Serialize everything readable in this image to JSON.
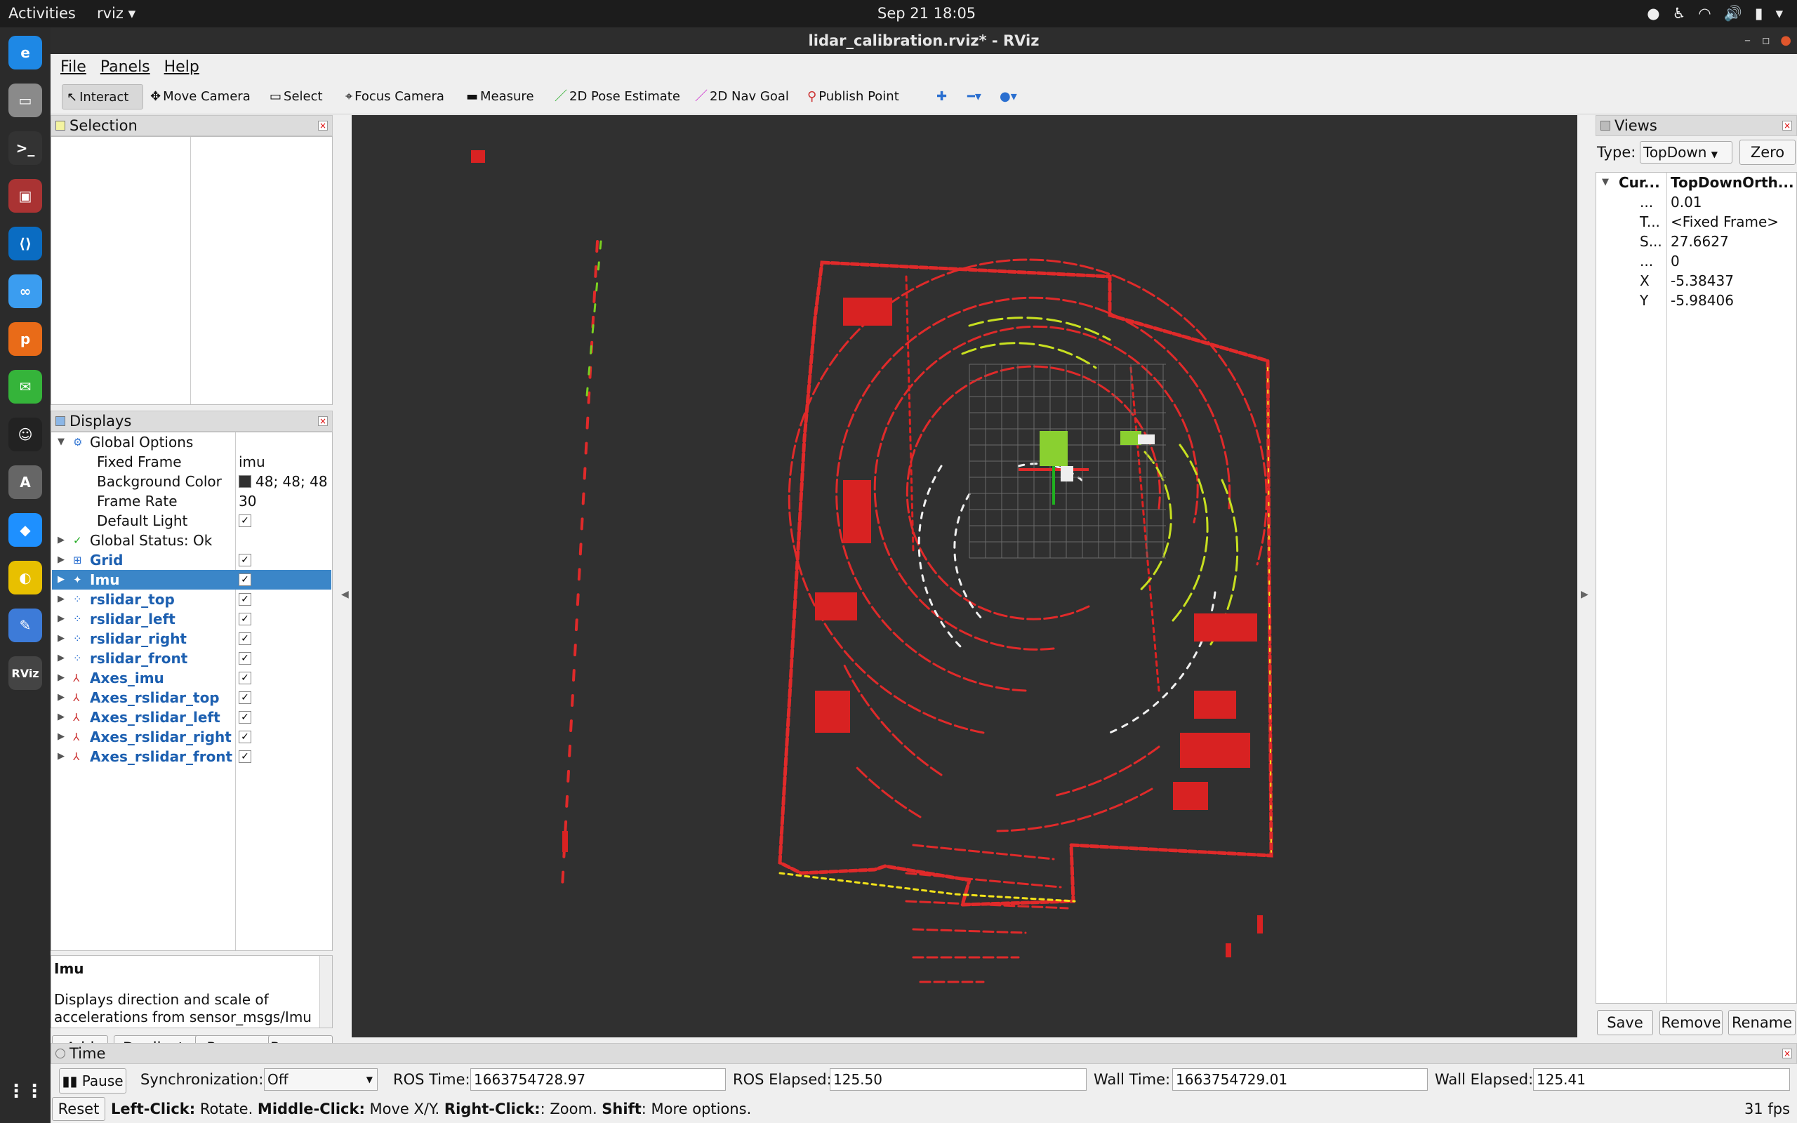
{
  "topbar": {
    "activities": "Activities",
    "app": "rviz",
    "clock": "Sep 21  18:05"
  },
  "window": {
    "title": "lidar_calibration.rviz* - RViz"
  },
  "menu": {
    "file": "File",
    "panels": "Panels",
    "help": "Help"
  },
  "toolbar": {
    "interact": "Interact",
    "move_camera": "Move Camera",
    "select": "Select",
    "focus_camera": "Focus Camera",
    "measure": "Measure",
    "pose_estimate": "2D Pose Estimate",
    "nav_goal": "2D Nav Goal",
    "publish_point": "Publish Point"
  },
  "selection": {
    "title": "Selection"
  },
  "displays": {
    "title": "Displays",
    "global_options": "Global Options",
    "fixed_frame": {
      "name": "Fixed Frame",
      "value": "imu"
    },
    "background_color": {
      "name": "Background Color",
      "value": "48; 48; 48"
    },
    "frame_rate": {
      "name": "Frame Rate",
      "value": "30"
    },
    "default_light": {
      "name": "Default Light"
    },
    "global_status": "Global Status: Ok",
    "items": [
      "Grid",
      "Imu",
      "rslidar_top",
      "rslidar_left",
      "rslidar_right",
      "rslidar_front",
      "Axes_imu",
      "Axes_rslidar_top",
      "Axes_rslidar_left",
      "Axes_rslidar_right",
      "Axes_rslidar_front"
    ],
    "desc_title": "Imu",
    "desc_text": "Displays direction and scale of accelerations from sensor_msgs/Imu",
    "buttons": {
      "add": "Add",
      "duplicate": "Duplicate",
      "remove": "Remove",
      "rename": "Rename"
    }
  },
  "views": {
    "title": "Views",
    "type_label": "Type:",
    "type_value": "TopDown",
    "zero": "Zero",
    "current_name": "Cur...",
    "current_value": "TopDownOrth...",
    "props": [
      {
        "k": "...",
        "v": "0.01"
      },
      {
        "k": "T...",
        "v": "<Fixed Frame>"
      },
      {
        "k": "S...",
        "v": "27.6627"
      },
      {
        "k": "...",
        "v": "0"
      },
      {
        "k": "X",
        "v": "-5.38437"
      },
      {
        "k": "Y",
        "v": "-5.98406"
      }
    ],
    "buttons": {
      "save": "Save",
      "remove": "Remove",
      "rename": "Rename"
    }
  },
  "time": {
    "title": "Time",
    "pause": "Pause",
    "sync_label": "Synchronization:",
    "sync_value": "Off",
    "ros_time_label": "ROS Time:",
    "ros_time": "1663754728.97",
    "ros_elapsed_label": "ROS Elapsed:",
    "ros_elapsed": "125.50",
    "wall_time_label": "Wall Time:",
    "wall_time": "1663754729.01",
    "wall_elapsed_label": "Wall Elapsed:",
    "wall_elapsed": "125.41"
  },
  "status": {
    "reset": "Reset",
    "lc": "Left-Click:",
    "lc_t": " Rotate. ",
    "mc": "Middle-Click:",
    "mc_t": " Move X/Y. ",
    "rc": "Right-Click:",
    "rc_t": ": Zoom. ",
    "sh": "Shift",
    "sh_t": ": More options.",
    "fps": "31 fps"
  }
}
